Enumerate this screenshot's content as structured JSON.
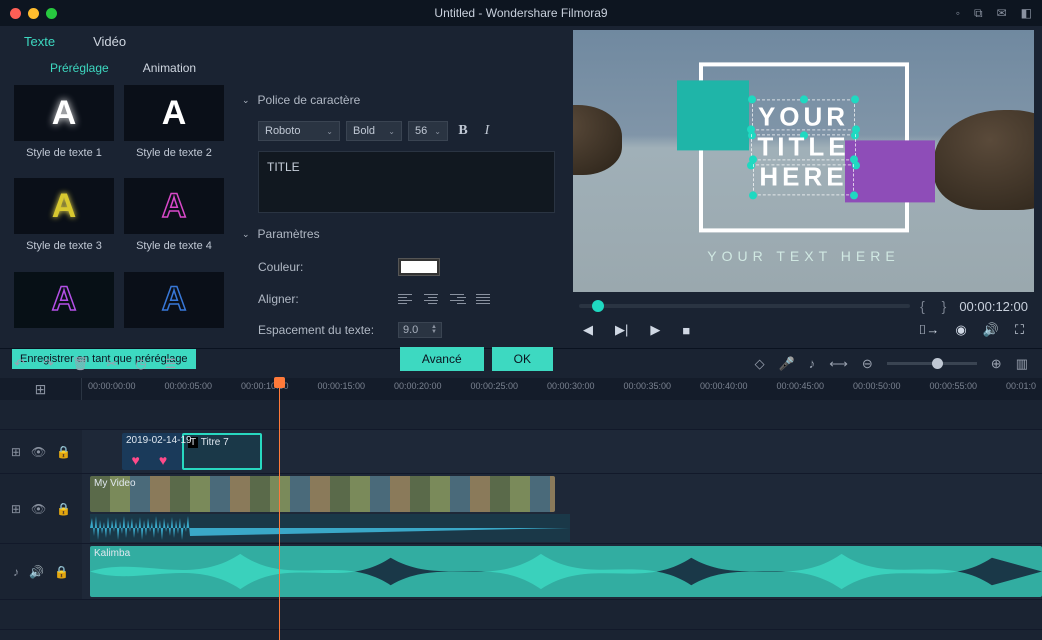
{
  "titlebar": {
    "title": "Untitled - Wondershare Filmora9"
  },
  "tabs": {
    "text": "Texte",
    "video": "Vidéo"
  },
  "subtabs": {
    "preset": "Préréglage",
    "animation": "Animation"
  },
  "presets": [
    {
      "label": "Style de texte 1"
    },
    {
      "label": "Style de texte 2"
    },
    {
      "label": "Style de texte 3"
    },
    {
      "label": "Style de texte 4"
    }
  ],
  "font": {
    "section": "Police de caractère",
    "family": "Roboto",
    "weight": "Bold",
    "size": "56",
    "bold": "B",
    "italic": "I",
    "content": "TITLE"
  },
  "params": {
    "section": "Paramètres",
    "color_label": "Couleur:",
    "align_label": "Aligner:",
    "spacing_label": "Espacement du texte:",
    "spacing_value": "9.0"
  },
  "buttons": {
    "save_preset": "Enregistrer en tant que préréglage",
    "advanced": "Avancé",
    "ok": "OK"
  },
  "preview": {
    "line1": "YOUR",
    "line2": "TITLE",
    "line3": "HERE",
    "subtitle": "YOUR TEXT HERE",
    "timecode": "00:00:12:00"
  },
  "ruler_marks": [
    "00:00:00:00",
    "00:00:05:00",
    "00:00:10:00",
    "00:00:15:00",
    "00:00:20:00",
    "00:00:25:00",
    "00:00:30:00",
    "00:00:35:00",
    "00:00:40:00",
    "00:00:45:00",
    "00:00:50:00",
    "00:00:55:00",
    "00:01:0"
  ],
  "clips": {
    "date": "2019-02-14-19",
    "title": "Titre 7",
    "video": "My Video",
    "audio": "Kalimba"
  }
}
